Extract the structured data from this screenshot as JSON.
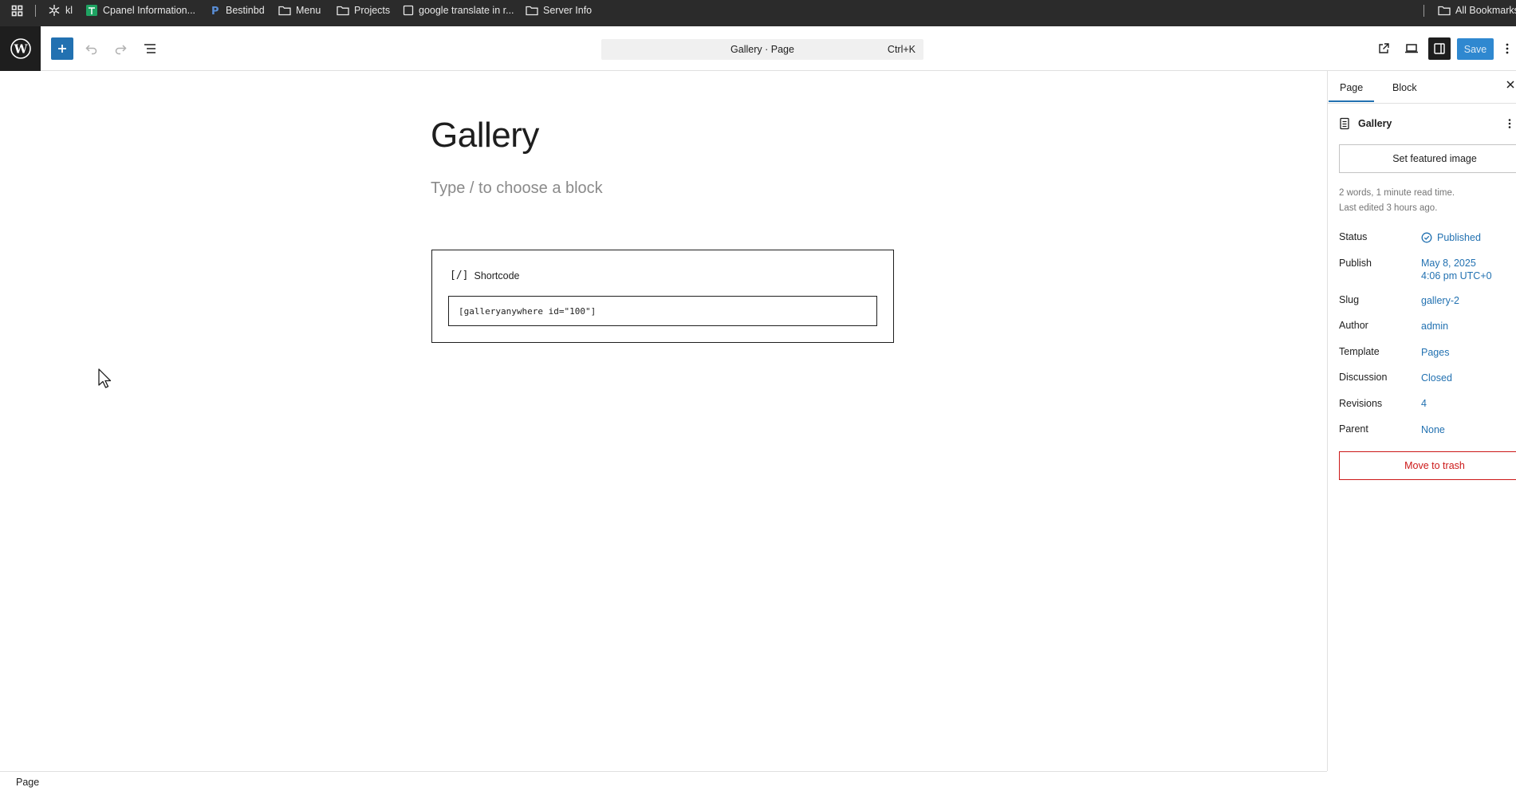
{
  "bookmarks_bar": {
    "items": [
      {
        "label": "kl",
        "icon": "snowflake-icon"
      },
      {
        "label": "Cpanel Information...",
        "icon": "sheets-icon"
      },
      {
        "label": "Bestinbd",
        "icon": "p-logo-icon"
      },
      {
        "label": "Menu",
        "icon": "folder-icon"
      },
      {
        "label": "Projects",
        "icon": "folder-icon"
      },
      {
        "label": "google translate in r...",
        "icon": "page-icon"
      },
      {
        "label": "Server Info",
        "icon": "folder-icon"
      }
    ],
    "all_bookmarks": "All Bookmarks"
  },
  "toolbar": {
    "command_title": "Gallery · Page",
    "shortcut": "Ctrl+K",
    "save_label": "Save"
  },
  "editor": {
    "title": "Gallery",
    "placeholder": "Type / to choose a block",
    "shortcode_block": {
      "icon_glyph": "[/]",
      "label": "Shortcode",
      "value": "[galleryanywhere id=\"100\"]"
    }
  },
  "sidebar": {
    "tabs": [
      "Page",
      "Block"
    ],
    "active_tab": "Page",
    "doc_title": "Gallery",
    "featured_image_button": "Set featured image",
    "meta_words": "2 words, 1 minute read time.",
    "meta_edited": "Last edited 3 hours ago.",
    "props": {
      "status": {
        "label": "Status",
        "value": "Published"
      },
      "publish": {
        "label": "Publish",
        "line1": "May 8, 2025",
        "line2": "4:06 pm UTC+0"
      },
      "slug": {
        "label": "Slug",
        "value": "gallery-2"
      },
      "author": {
        "label": "Author",
        "value": "admin"
      },
      "template": {
        "label": "Template",
        "value": "Pages"
      },
      "discussion": {
        "label": "Discussion",
        "value": "Closed"
      },
      "revisions": {
        "label": "Revisions",
        "value": "4"
      },
      "parent": {
        "label": "Parent",
        "value": "None"
      }
    },
    "trash_button": "Move to trash"
  },
  "footer": {
    "breadcrumb": "Page"
  },
  "colors": {
    "accent": "#2271b1",
    "danger": "#cc1818",
    "dark": "#1e1e1e",
    "bookmarks_bg": "#2b2b2b"
  }
}
